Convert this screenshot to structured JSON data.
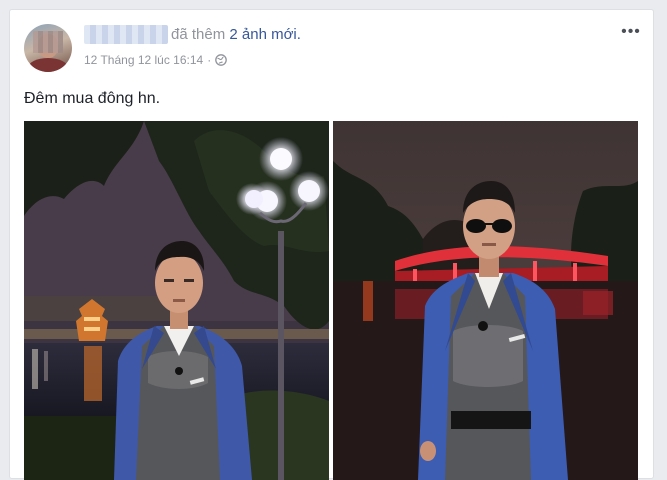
{
  "post": {
    "action_text": "đã thêm",
    "action_link": "2 ảnh mới",
    "action_end": ".",
    "timestamp": "12 Tháng 12 lúc 16:14",
    "privacy_icon": "globe-icon",
    "more_icon": "more-options-icon",
    "more_label": "•••",
    "message": "Đêm mua đông hn.",
    "photos": [
      {
        "subject": "man in blue blazer by lake with lit pagoda at night"
      },
      {
        "subject": "man in sunglasses and blue blazer in front of red lit bridge at night"
      }
    ]
  },
  "colors": {
    "link": "#365899",
    "meta": "#90949c",
    "text": "#1d2129",
    "background": "#e9ebee"
  }
}
